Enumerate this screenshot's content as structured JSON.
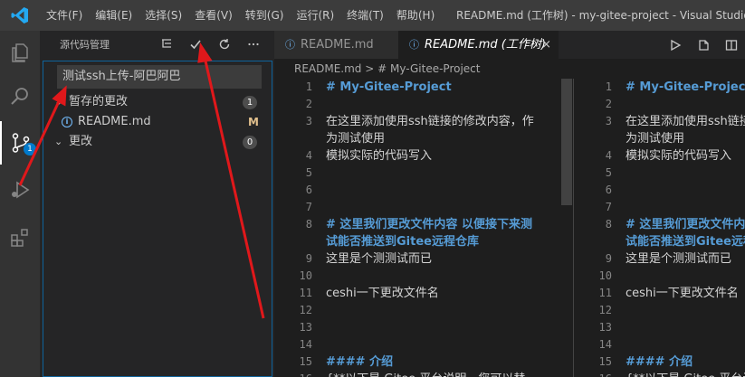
{
  "titlebar": {
    "menus": [
      "文件(F)",
      "编辑(E)",
      "选择(S)",
      "查看(V)",
      "转到(G)",
      "运行(R)",
      "终端(T)",
      "帮助(H)"
    ],
    "window_title": "README.md (工作树) - my-gitee-project - Visual Studio Code"
  },
  "activity": {
    "items": [
      "files-icon",
      "search-icon",
      "source-control-icon",
      "run-debug-icon",
      "extensions-icon"
    ],
    "scm_badge": "1"
  },
  "sidebar": {
    "title": "源代码管理",
    "commit_message": "测试ssh上传-阿巴阿巴",
    "staged_group": {
      "label": "暂存的更改",
      "count": "1"
    },
    "staged_file": {
      "name": "README.md",
      "status": "M"
    },
    "changes_group": {
      "label": "更改",
      "count": "0"
    }
  },
  "tabs": [
    {
      "label": "README.md"
    },
    {
      "label": "README.md (工作树)",
      "close": "×"
    }
  ],
  "breadcrumb": "README.md  >  # My-Gitee-Project",
  "editor": {
    "lines": [
      {
        "n": "1",
        "t": "# My-Gitee-Project",
        "h": true
      },
      {
        "n": "2",
        "t": ""
      },
      {
        "n": "3",
        "t": "在这里添加使用ssh链接的修改内容，作"
      },
      {
        "n": "",
        "t": "为测试使用"
      },
      {
        "n": "4",
        "t": "模拟实际的代码写入"
      },
      {
        "n": "5",
        "t": ""
      },
      {
        "n": "6",
        "t": ""
      },
      {
        "n": "7",
        "t": ""
      },
      {
        "n": "8",
        "t": "# 这里我们更改文件内容 以便接下来测",
        "h": true
      },
      {
        "n": "",
        "t": "试能否推送到Gitee远程仓库",
        "h": true
      },
      {
        "n": "9",
        "t": "这里是个测测试而已"
      },
      {
        "n": "10",
        "t": ""
      },
      {
        "n": "11",
        "t": "ceshi一下更改文件名"
      },
      {
        "n": "12",
        "t": ""
      },
      {
        "n": "13",
        "t": ""
      },
      {
        "n": "14",
        "t": ""
      },
      {
        "n": "15",
        "t": "#### 介绍",
        "h": true
      },
      {
        "n": "16",
        "t": "{**以下是 Gitee 平台说明，您可以替"
      }
    ],
    "right_lines": [
      {
        "n": "1",
        "t": "# My-Gitee-Project",
        "h": true
      },
      {
        "n": "2",
        "t": ""
      },
      {
        "n": "3",
        "t": "在这里添加使用ssh链接的修改内容"
      },
      {
        "n": "",
        "t": "为测试使用"
      },
      {
        "n": "4",
        "t": "模拟实际的代码写入"
      },
      {
        "n": "5",
        "t": ""
      },
      {
        "n": "6",
        "t": ""
      },
      {
        "n": "7",
        "t": ""
      },
      {
        "n": "8",
        "t": "# 这里我们更改文件内容",
        "h": true
      },
      {
        "n": "",
        "t": "试能否推送到Gitee远程仓库",
        "h": true
      },
      {
        "n": "9",
        "t": "这里是个测测试而已"
      },
      {
        "n": "10",
        "t": ""
      },
      {
        "n": "11",
        "t": "ceshi一下更改文件名"
      },
      {
        "n": "12",
        "t": ""
      },
      {
        "n": "13",
        "t": ""
      },
      {
        "n": "14",
        "t": ""
      },
      {
        "n": "15",
        "t": "#### 介绍",
        "h": true
      },
      {
        "n": "16",
        "t": "{**以下是 Gitee 平台说明"
      }
    ]
  },
  "colors": {
    "accent": "#007acc",
    "annotation_arrow": "#e0181b"
  }
}
